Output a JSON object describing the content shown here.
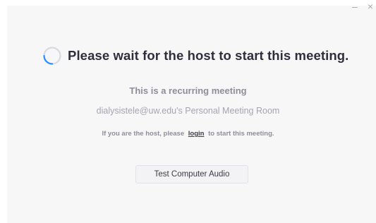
{
  "window_controls": {
    "minimize_glyph": "–",
    "close_glyph": "×"
  },
  "main": {
    "status_icon": "loading-spinner-icon",
    "headline": "Please wait for the host to start this meeting.",
    "recurring_note": "This is a recurring meeting",
    "room_name": "dialysistele@uw.edu's Personal Meeting Room",
    "host_prompt_before": "If you are the host, please",
    "login_link": "login",
    "host_prompt_after": "to start this meeting.",
    "audio_button_label": "Test Computer Audio"
  },
  "colors": {
    "spinner_ring": "#d9d9df",
    "spinner_arc": "#2d8cff",
    "panel_background": "#f7f7f8"
  }
}
